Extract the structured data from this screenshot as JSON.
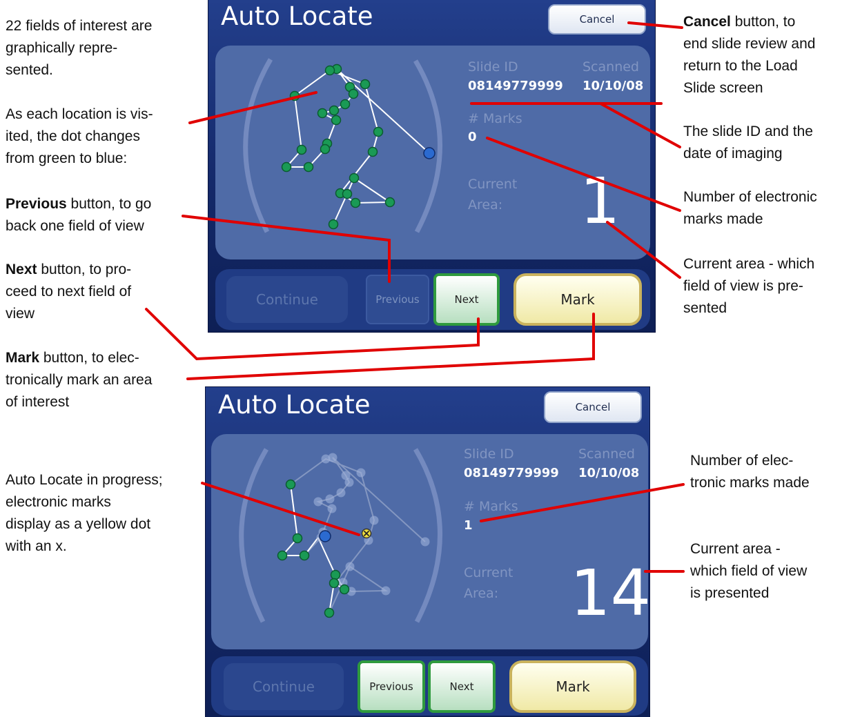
{
  "colors": {
    "visited_dot": "#2b6ad0",
    "unvisited_dot": "#1a9a55",
    "mark_dot": "#f0e040",
    "callout_line": "#e00000",
    "panel": "#4f6ba7"
  },
  "annotations": {
    "fields_1": "22 fields of interest are",
    "fields_2": "graphically repre-",
    "fields_3": "sented.",
    "visit_1": "As each location is vis-",
    "visit_2": "ited, the dot changes",
    "visit_3": "from green to blue:",
    "prev_bold": "Previous",
    "prev_1": " button, to go",
    "prev_2": "back one field of view",
    "next_bold": "Next",
    "next_1": " button, to pro-",
    "next_2": "ceed to next field of",
    "next_3": "view",
    "mark_bold": "Mark",
    "mark_1": " button, to elec-",
    "mark_2": "tronically mark an area",
    "mark_3": "of interest",
    "cancel_bold": "Cancel",
    "cancel_1": " button, to",
    "cancel_2": "end slide review and",
    "cancel_3": "return to the Load",
    "cancel_4": "Slide screen",
    "slideid_1": "The slide ID and the",
    "slideid_2": "date of imaging",
    "marks_1": "Number of electronic",
    "marks_2": "marks made",
    "area_1": "Current area - which",
    "area_2": "field of view is pre-",
    "area_3": "sented",
    "progress_1": "Auto Locate in progress;",
    "progress_2": "electronic marks",
    "progress_3": "display as a yellow dot",
    "progress_4": "with an x.",
    "marks2_1": "Number of elec-",
    "marks2_2": "tronic marks made",
    "area2_1": "Current area -",
    "area2_2": "which field of view",
    "area2_3": "is presented"
  },
  "screens": [
    {
      "title": "Auto Locate",
      "cancel": "Cancel",
      "slide_id_label": "Slide ID",
      "slide_id": "08149779999",
      "scanned_label": "Scanned",
      "scanned": "10/10/08",
      "marks_label": "# Marks",
      "marks": "0",
      "current_label_1": "Current",
      "current_label_2": "Area:",
      "current_area": "1",
      "buttons": {
        "continue": "Continue",
        "previous": "Previous",
        "next": "Next",
        "mark": "Mark"
      }
    },
    {
      "title": "Auto Locate",
      "cancel": "Cancel",
      "slide_id_label": "Slide ID",
      "slide_id": "08149779999",
      "scanned_label": "Scanned",
      "scanned": "10/10/08",
      "marks_label": "# Marks",
      "marks": "1",
      "current_label_1": "Current",
      "current_label_2": "Area:",
      "current_area": "14",
      "buttons": {
        "continue": "Continue",
        "previous": "Previous",
        "next": "Next",
        "mark": "Mark"
      }
    }
  ]
}
